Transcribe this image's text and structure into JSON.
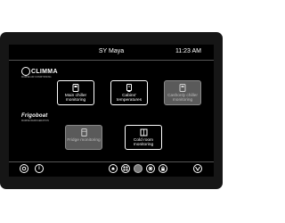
{
  "statusbar": {
    "title": "SY Maya",
    "time": "11:23 AM"
  },
  "brand": {
    "logo_text": "CLIMMA",
    "logo_tagline": "MARINE AIR CONDITIONING",
    "logo2_text": "Frigoboat",
    "logo2_tagline": "MARINE REFRIGERATION"
  },
  "tiles": [
    {
      "label": "Main chiller monitoring",
      "icon": "chiller-icon",
      "enabled": true
    },
    {
      "label": "Cabins' temperatures",
      "icon": "thermometer-icon",
      "enabled": true
    },
    {
      "label": "Cashonly chiller monitoring",
      "icon": "chiller-icon",
      "enabled": false
    },
    {
      "label": "Fridge monitoring",
      "icon": "fridge-icon",
      "enabled": false
    },
    {
      "label": "Cold room monitoring",
      "icon": "coldroom-icon",
      "enabled": true
    }
  ],
  "bottombar": {
    "icons": [
      "settings-icon",
      "info-icon",
      "alarm-icon",
      "grid-icon",
      "circle-icon",
      "snowflake-icon",
      "lock-icon",
      "logo-icon"
    ]
  }
}
